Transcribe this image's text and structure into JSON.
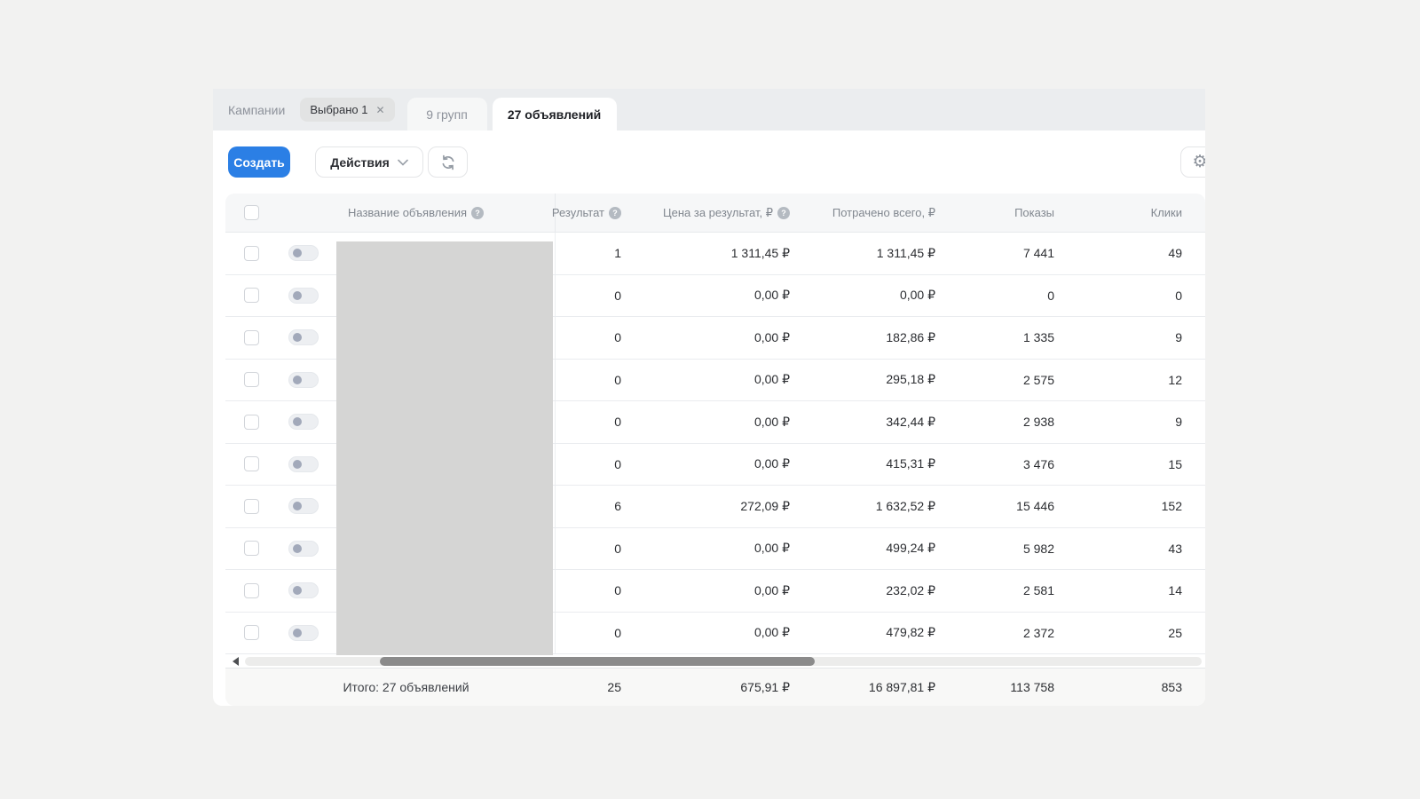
{
  "accent_color": "#2b7fe5",
  "redaction_color": "#d5d5d4",
  "icons": {
    "help": "?",
    "chip_close": "✕",
    "gear": "⚙"
  },
  "tabs": {
    "campaigns": "Кампании",
    "selected_chip": "Выбрано 1",
    "groups": "9 групп",
    "ads": "27 объявлений"
  },
  "toolbar": {
    "create": "Создать",
    "actions": "Действия"
  },
  "table": {
    "headers": {
      "name": "Название объявления",
      "result": "Результат",
      "cost_per_result": "Цена за результат, ₽",
      "spent_total": "Потрачено всего, ₽",
      "impressions": "Показы",
      "clicks": "Клики"
    },
    "rows": [
      {
        "result": "1",
        "cost_per_result": "1 311,45 ₽",
        "spent_total": "1 311,45 ₽",
        "impressions": "7 441",
        "clicks": "49"
      },
      {
        "result": "0",
        "cost_per_result": "0,00 ₽",
        "spent_total": "0,00 ₽",
        "impressions": "0",
        "clicks": "0"
      },
      {
        "result": "0",
        "cost_per_result": "0,00 ₽",
        "spent_total": "182,86 ₽",
        "impressions": "1 335",
        "clicks": "9"
      },
      {
        "result": "0",
        "cost_per_result": "0,00 ₽",
        "spent_total": "295,18 ₽",
        "impressions": "2 575",
        "clicks": "12"
      },
      {
        "result": "0",
        "cost_per_result": "0,00 ₽",
        "spent_total": "342,44 ₽",
        "impressions": "2 938",
        "clicks": "9"
      },
      {
        "result": "0",
        "cost_per_result": "0,00 ₽",
        "spent_total": "415,31 ₽",
        "impressions": "3 476",
        "clicks": "15"
      },
      {
        "result": "6",
        "cost_per_result": "272,09 ₽",
        "spent_total": "1 632,52 ₽",
        "impressions": "15 446",
        "clicks": "152"
      },
      {
        "result": "0",
        "cost_per_result": "0,00 ₽",
        "spent_total": "499,24 ₽",
        "impressions": "5 982",
        "clicks": "43"
      },
      {
        "result": "0",
        "cost_per_result": "0,00 ₽",
        "spent_total": "232,02 ₽",
        "impressions": "2 581",
        "clicks": "14"
      },
      {
        "result": "0",
        "cost_per_result": "0,00 ₽",
        "spent_total": "479,82 ₽",
        "impressions": "2 372",
        "clicks": "25"
      }
    ],
    "footer": {
      "total_label": "Итого: 27 объявлений",
      "result": "25",
      "cost_per_result": "675,91 ₽",
      "spent_total": "16 897,81 ₽",
      "impressions": "113 758",
      "clicks": "853"
    }
  }
}
